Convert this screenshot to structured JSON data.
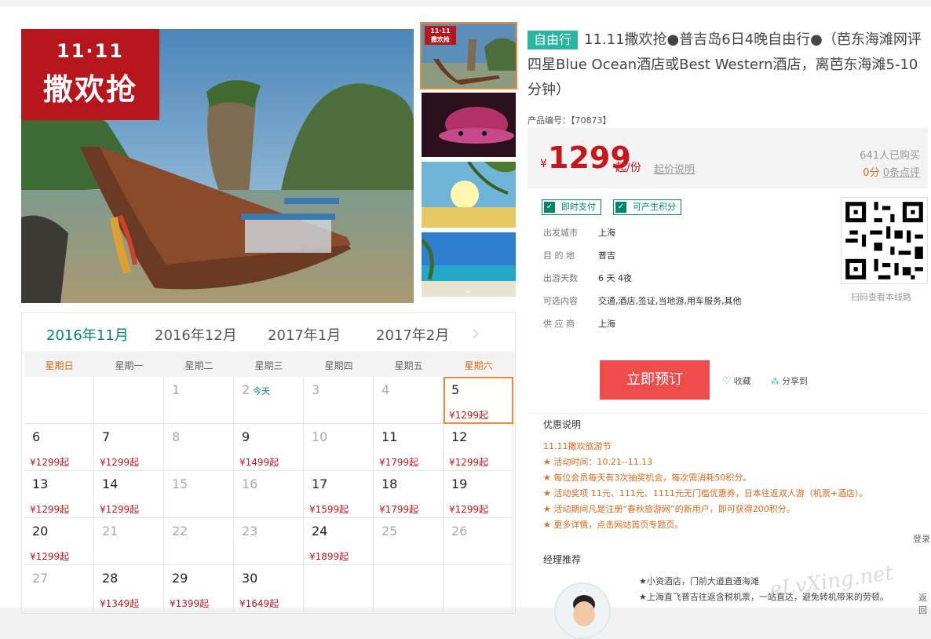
{
  "gallery": {
    "main_badge_top": "11·11",
    "main_badge_text": "撒欢抢",
    "thumb_badge_top": "11·11",
    "thumb_badge_text": "撒欢抢",
    "thumb_arrow": "⌄"
  },
  "calendar": {
    "months": [
      "2016年11月",
      "2016年12月",
      "2017年1月",
      "2017年2月"
    ],
    "next_arrow": "›",
    "weekdays": [
      "星期日",
      "星期一",
      "星期二",
      "星期三",
      "星期四",
      "星期五",
      "星期六"
    ],
    "today_label": "今天",
    "rows": [
      [
        {
          "d": ""
        },
        {
          "d": ""
        },
        {
          "d": "1",
          "past": true
        },
        {
          "d": "2",
          "past": true,
          "today": true
        },
        {
          "d": "3",
          "past": true
        },
        {
          "d": "4",
          "past": true
        },
        {
          "d": "5",
          "p": "¥1299起",
          "sel": true
        }
      ],
      [
        {
          "d": "6",
          "p": "¥1299起"
        },
        {
          "d": "7",
          "p": "¥1299起"
        },
        {
          "d": "8",
          "past": true
        },
        {
          "d": "9",
          "p": "¥1499起"
        },
        {
          "d": "10",
          "past": true
        },
        {
          "d": "11",
          "p": "¥1799起"
        },
        {
          "d": "12",
          "p": "¥1299起"
        }
      ],
      [
        {
          "d": "13",
          "p": "¥1299起"
        },
        {
          "d": "14",
          "p": "¥1299起"
        },
        {
          "d": "15",
          "past": true
        },
        {
          "d": "16",
          "past": true
        },
        {
          "d": "17",
          "p": "¥1599起"
        },
        {
          "d": "18",
          "p": "¥1799起"
        },
        {
          "d": "19",
          "p": "¥1299起"
        }
      ],
      [
        {
          "d": "20",
          "p": "¥1299起"
        },
        {
          "d": "21",
          "past": true
        },
        {
          "d": "22",
          "past": true
        },
        {
          "d": "23",
          "past": true
        },
        {
          "d": "24",
          "p": "¥1899起"
        },
        {
          "d": "25",
          "past": true
        },
        {
          "d": "26",
          "past": true
        }
      ],
      [
        {
          "d": "27",
          "past": true
        },
        {
          "d": "28",
          "p": "¥1349起"
        },
        {
          "d": "29",
          "p": "¥1399起"
        },
        {
          "d": "30",
          "p": "¥1649起"
        },
        {
          "d": ""
        },
        {
          "d": ""
        },
        {
          "d": ""
        }
      ]
    ]
  },
  "product": {
    "tag": "自由行",
    "title": "11.11撒欢抢●普吉岛6日4晚自由行●（芭东海滩网评四星Blue Ocean酒店或Best Western酒店，离芭东海滩5-10分钟）",
    "code": "产品编号：【70873】",
    "yen": "¥",
    "price": "1299",
    "per": "起/份",
    "price_explain": "起价说明",
    "bought": "641人已购买",
    "score": "0分",
    "reviews": "0条点评",
    "badge_pay": "即时支付",
    "badge_points": "可产生积分",
    "info": [
      {
        "label": "出发城市",
        "value": "上海"
      },
      {
        "label": "目 的 地",
        "value": "普吉"
      },
      {
        "label": "出游天数",
        "value": "6 天 4夜"
      },
      {
        "label": "可选内容",
        "value": "交通,酒店,签证,当地游,用车服务,其他"
      },
      {
        "label": "供 应 商",
        "value": "上海"
      }
    ],
    "qr_caption": "扫码查看本线路",
    "book_label": "立即预订",
    "fav_label": "收藏",
    "share_label": "分享到"
  },
  "promo": {
    "heading": "优惠说明",
    "lines": [
      "11.11撒欢旅游节",
      "★ 活动时间：10.21--11.13",
      "★ 每位会员每天有3次抽奖机会，每次需消耗50积分。",
      "★ 活动奖项 11元、111元、1111元无门槛优惠券，日本往返双人游（机票+酒店）。",
      "★ 活动期间凡是注册“春秋旅游网”的新用户，即可获得200积分。",
      "★ 更多详情，点击网站首页专题页。"
    ]
  },
  "manager": {
    "heading": "经理推荐",
    "lines": [
      "★小资酒店，门前大道直通海滩",
      "★上海直飞普吉往返含税机票，一站直达，避免转机带来的劳顿。"
    ]
  },
  "side": {
    "login": "登录",
    "back": "返回"
  },
  "watermark": "eLvXing.net"
}
